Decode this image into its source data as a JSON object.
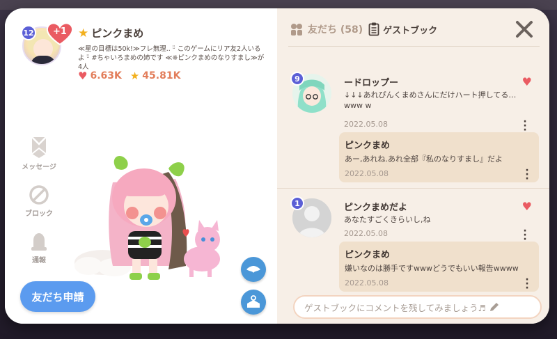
{
  "profile": {
    "level": "12",
    "heart_badge": "+1",
    "name": "ピンクまめ",
    "bio": "≪星の目標は50k!≫フレ無理.. ᵕ̈ このゲームにリア友2人いるよ ᵕ̈ #ちゃいろまめの姉です ≪※ピンクまめのなりすまし≫が4人",
    "hearts": "6.63K",
    "stars": "45.81K"
  },
  "side_actions": {
    "message": "メッセージ",
    "block": "ブロック",
    "report": "通報"
  },
  "buttons": {
    "friend_request": "友だち申請"
  },
  "tabs": {
    "friends": "友だち (58)",
    "guestbook": "ゲストブック"
  },
  "entries": [
    {
      "level": "9",
      "name": "ードロップー",
      "text": "↓↓↓あれぴんくまめさんにだけハート押してる…www w",
      "date": "2022.05.08",
      "reply": {
        "name": "ピンクまめ",
        "text": "あー,あれね.あれ全部『私のなりすまし』だよ",
        "date": "2022.05.08"
      }
    },
    {
      "level": "1",
      "name": "ピンクまめだよ",
      "text": "あなたすごくきらいし,ね",
      "date": "2022.05.08",
      "reply": {
        "name": "ピンクまめ",
        "text": "嫌いなのは勝手ですwwwどうでもいい報告wwww",
        "date": "2022.05.08"
      }
    }
  ],
  "comment_input": {
    "placeholder": "ゲストブックにコメントを残してみましょう♬"
  },
  "colors": {
    "accent_blue": "#5b9bef",
    "heart_red": "#ea5b62",
    "star_gold": "#f2b01e",
    "level_badge": "#5b5fd6",
    "panel_bg": "#f7efe7",
    "reply_bg": "#f0e0cc"
  },
  "icons": {
    "close": "close-icon",
    "friends": "friends-icon",
    "guestbook": "guestbook-icon",
    "message": "message-icon",
    "block": "block-icon",
    "report": "bell-icon",
    "emote": "emote-icon",
    "outfit": "shirt-icon",
    "pencil": "pencil-icon"
  }
}
